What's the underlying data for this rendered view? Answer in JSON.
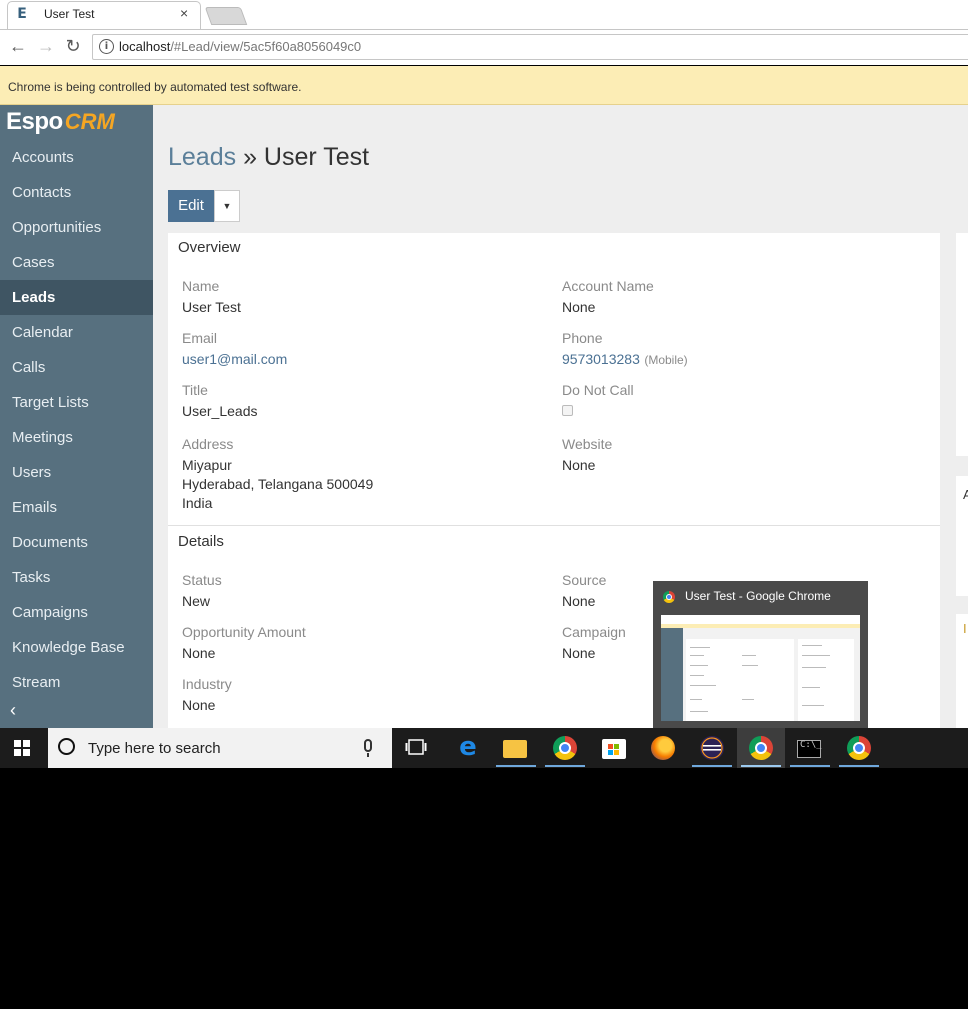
{
  "browser": {
    "tab_title": "User Test",
    "tab_favicon": "E",
    "close_glyph": "×",
    "url_host": "localhost",
    "url_path": "/#Lead/view/5ac5f60a8056049c0",
    "infobar_text": "Chrome is being controlled by automated test software.",
    "icons": [
      "back-arrow-icon",
      "forward-arrow-icon",
      "reload-icon",
      "info-icon"
    ]
  },
  "sidebar": {
    "logo_espo": "Espo",
    "logo_crm": "CRM",
    "items": [
      {
        "label": "Accounts"
      },
      {
        "label": "Contacts"
      },
      {
        "label": "Opportunities"
      },
      {
        "label": "Cases"
      },
      {
        "label": "Leads",
        "active": true
      },
      {
        "label": "Calendar"
      },
      {
        "label": "Calls"
      },
      {
        "label": "Target Lists"
      },
      {
        "label": "Meetings"
      },
      {
        "label": "Users"
      },
      {
        "label": "Emails"
      },
      {
        "label": "Documents"
      },
      {
        "label": "Tasks"
      },
      {
        "label": "Campaigns"
      },
      {
        "label": "Knowledge Base"
      },
      {
        "label": "Stream"
      }
    ],
    "collapse_glyph": "‹"
  },
  "header": {
    "scope": "Leads",
    "separator": " » ",
    "record": "User Test"
  },
  "actions": {
    "edit_label": "Edit",
    "dropdown_glyph": "▼"
  },
  "overview": {
    "title": "Overview",
    "name_label": "Name",
    "name_value": "User Test",
    "account_label": "Account Name",
    "account_value": "None",
    "email_label": "Email",
    "email_value": "user1@mail.com",
    "phone_label": "Phone",
    "phone_value": "9573013283",
    "phone_type": "(Mobile)",
    "title_label": "Title",
    "title_value": "User_Leads",
    "dnc_label": "Do Not Call",
    "address_label": "Address",
    "address_line1": "Miyapur",
    "address_line2": "Hyderabad, Telangana 500049",
    "address_line3": "India",
    "website_label": "Website",
    "website_value": "None"
  },
  "details": {
    "title": "Details",
    "status_label": "Status",
    "status_value": "New",
    "source_label": "Source",
    "source_value": "None",
    "opp_label": "Opportunity Amount",
    "opp_value": "None",
    "campaign_label": "Campaign",
    "campaign_value": "None",
    "industry_label": "Industry",
    "industry_value": "None"
  },
  "right_panels": {
    "panel2_char": "A",
    "panel3_char": "I"
  },
  "taskbar": {
    "search_placeholder": "Type here to search",
    "preview_title": "User Test - Google Chrome",
    "cmd_glyph": "C:\\_"
  },
  "colors": {
    "sidebar": "#57707f",
    "sidebar_active": "#3f5563",
    "primary_button": "#4b7193",
    "link": "#4b7193",
    "infobar": "#fcedb5",
    "logo_accent": "#f5a623"
  }
}
